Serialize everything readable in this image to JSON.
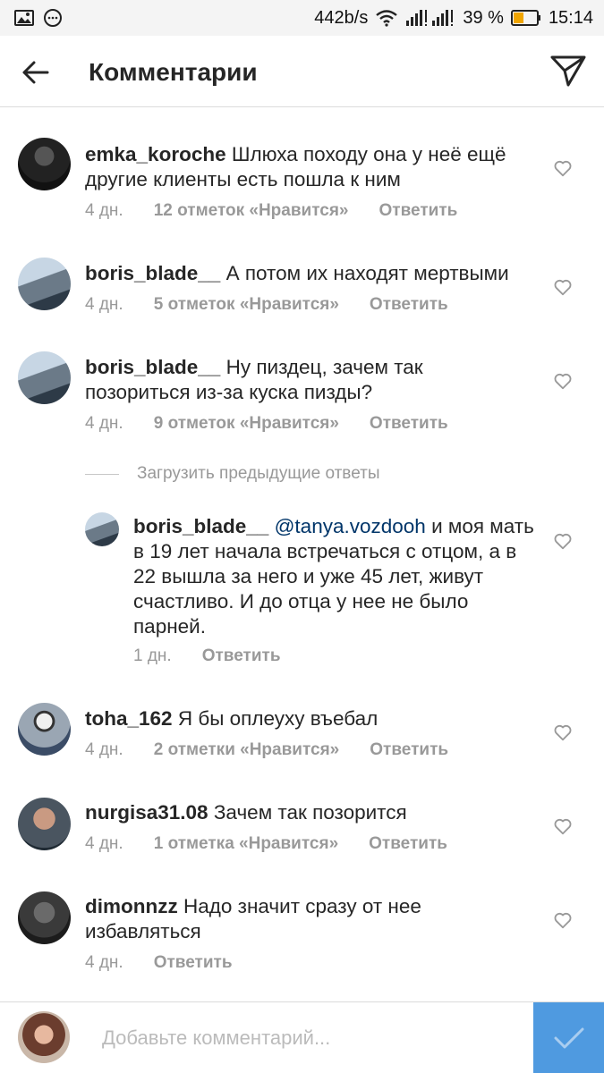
{
  "status_bar": {
    "speed": "442b/s",
    "battery_percent": "39 %",
    "time": "15:14",
    "icons": [
      "image-icon",
      "chat-icon",
      "wifi-icon",
      "signal-icon",
      "battery-icon"
    ]
  },
  "header": {
    "title": "Комментарии"
  },
  "comments": [
    {
      "username": "emka_koroche",
      "text": "Шлюха походу она у неё ещё другие клиенты есть пошла к ним",
      "time": "4 дн.",
      "likes": "12 отметок «Нравится»",
      "reply": "Ответить"
    },
    {
      "username": "boris_blade__",
      "text": "А потом их находят мертвыми",
      "time": "4 дн.",
      "likes": "5 отметок «Нравится»",
      "reply": "Ответить"
    },
    {
      "username": "boris_blade__",
      "text": "Ну пиздец, зачем так позориться из-за куска пизды?",
      "time": "4 дн.",
      "likes": "9 отметок «Нравится»",
      "reply": "Ответить"
    },
    {
      "username": "toha_162",
      "text": "Я бы оплеуху въебал",
      "time": "4 дн.",
      "likes": "2 отметки «Нравится»",
      "reply": "Ответить"
    },
    {
      "username": "nurgisa31.08",
      "text": "Зачем так позорится",
      "time": "4 дн.",
      "likes": "1 отметка «Нравится»",
      "reply": "Ответить"
    },
    {
      "username": "dimonnzz",
      "text": "Надо значит сразу от нее избавляться",
      "time": "4 дн.",
      "likes": "",
      "reply": "Ответить"
    }
  ],
  "load_more": "Загрузить предыдущие ответы",
  "reply_item": {
    "username": "boris_blade__",
    "mention": "@tanya.vozdooh",
    "text": "и моя мать в 19 лет начала встречаться с отцом, а в 22 вышла за него и уже 45 лет, живут счастливо. И до отца у нее не было парней.",
    "time": "1 дн.",
    "reply": "Ответить"
  },
  "composer": {
    "placeholder": "Добавьте комментарий..."
  },
  "colors": {
    "mention": "#003569",
    "meta": "#999999",
    "post_button": "#4f9ae0"
  }
}
